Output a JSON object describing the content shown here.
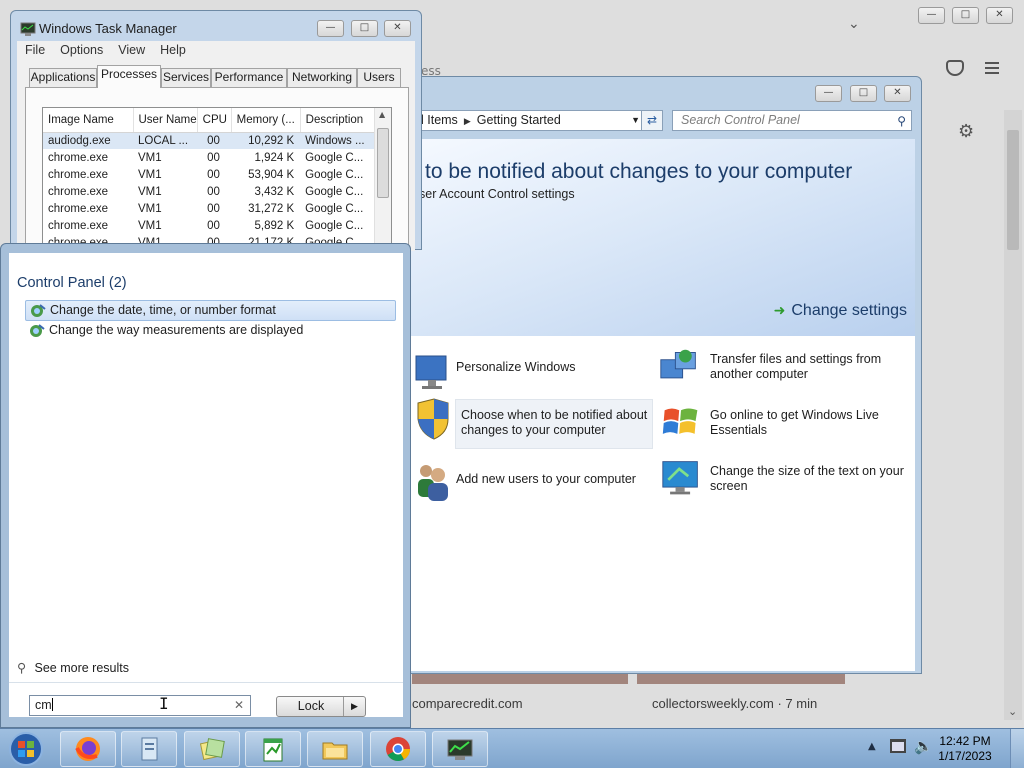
{
  "browser": {
    "fragment_text": "ess",
    "card1_caption": "comparecredit.com",
    "card2_caption": "collectorsweekly.com · 7 min"
  },
  "control_panel": {
    "address": {
      "crumb1": "l Items",
      "crumb2": "Getting Started"
    },
    "search_placeholder": "Search Control Panel",
    "banner_title": "to be notified about changes to your computer",
    "banner_subtitle": "ser Account Control settings",
    "change_settings_label": "Change settings",
    "tasks": [
      {
        "label": "Personalize Windows",
        "icon": "personalize-icon"
      },
      {
        "label": "Transfer files and settings from another computer",
        "icon": "transfer-icon"
      },
      {
        "label": "Choose when to be notified about changes to your computer",
        "icon": "uac-shield-icon"
      },
      {
        "label": "Go online to get Windows Live Essentials",
        "icon": "windows-live-icon"
      },
      {
        "label": "Add new users to your computer",
        "icon": "users-icon"
      },
      {
        "label": "Change the size of the text on your screen",
        "icon": "display-icon"
      }
    ]
  },
  "task_manager": {
    "title": "Windows Task Manager",
    "menu": [
      "File",
      "Options",
      "View",
      "Help"
    ],
    "tabs": [
      "Applications",
      "Processes",
      "Services",
      "Performance",
      "Networking",
      "Users"
    ],
    "active_tab": "Processes",
    "columns": [
      "Image Name",
      "User Name",
      "CPU",
      "Memory (...",
      "Description"
    ],
    "rows": [
      [
        "audiodg.exe",
        "LOCAL ...",
        "00",
        "10,292 K",
        "Windows ..."
      ],
      [
        "chrome.exe",
        "VM1",
        "00",
        "1,924 K",
        "Google C..."
      ],
      [
        "chrome.exe",
        "VM1",
        "00",
        "53,904 K",
        "Google C..."
      ],
      [
        "chrome.exe",
        "VM1",
        "00",
        "3,432 K",
        "Google C..."
      ],
      [
        "chrome.exe",
        "VM1",
        "00",
        "31,272 K",
        "Google C..."
      ],
      [
        "chrome.exe",
        "VM1",
        "00",
        "5,892 K",
        "Google C..."
      ],
      [
        "chrome.exe",
        "VM1",
        "00",
        "21,172 K",
        "Google C..."
      ]
    ]
  },
  "start_menu": {
    "heading": "Control Panel (2)",
    "results": [
      "Change the date, time, or number format",
      "Change the way measurements are displayed"
    ],
    "see_more": "See more results",
    "search_value": "cm",
    "lock_label": "Lock"
  },
  "taskbar": {
    "time": "12:42 PM",
    "date": "1/17/2023",
    "apps": [
      "firefox-icon",
      "document-icon",
      "sticky-notes-icon",
      "notepad-icon",
      "explorer-folder-icon",
      "chrome-icon",
      "task-manager-icon"
    ]
  }
}
